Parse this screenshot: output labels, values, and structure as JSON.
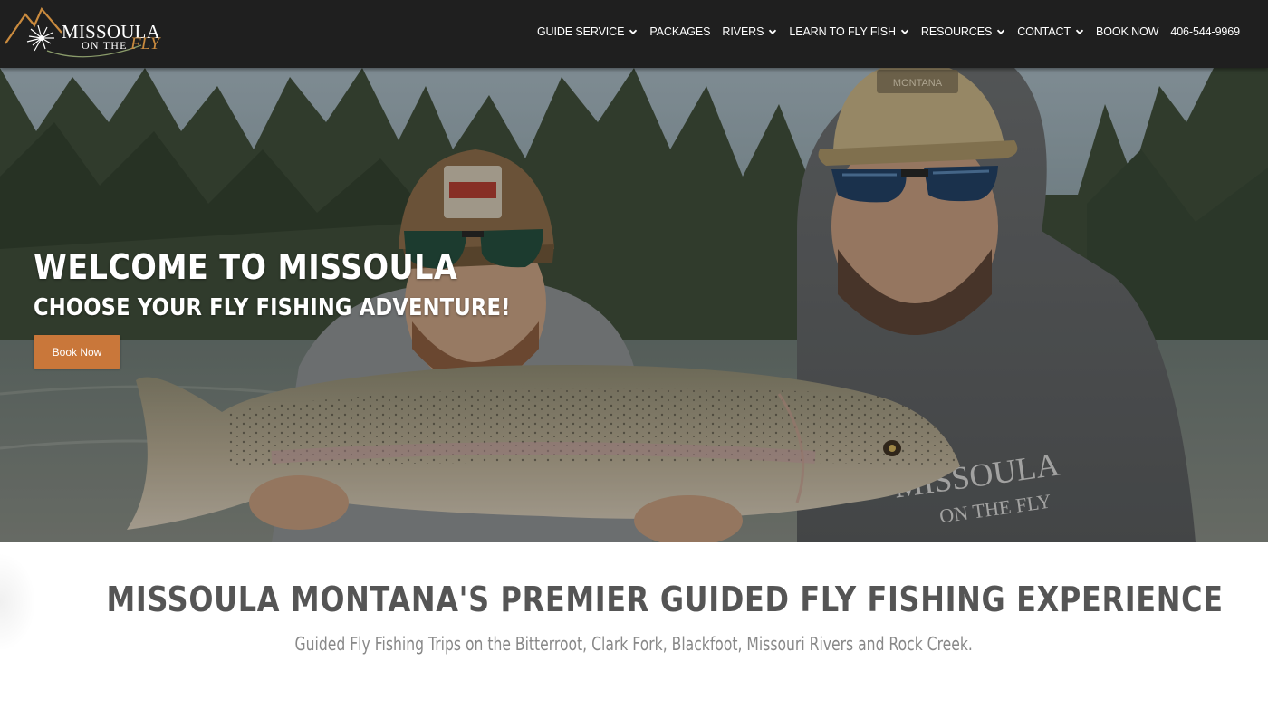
{
  "brand": {
    "logo_line1": "MISSOULA",
    "logo_line2": "ON THE",
    "logo_line3": "FLY"
  },
  "nav": {
    "items": [
      {
        "label": "GUIDE SERVICE",
        "has_dropdown": true
      },
      {
        "label": "PACKAGES",
        "has_dropdown": false
      },
      {
        "label": "RIVERS",
        "has_dropdown": true
      },
      {
        "label": "LEARN TO FLY FISH",
        "has_dropdown": true
      },
      {
        "label": "RESOURCES",
        "has_dropdown": true
      },
      {
        "label": "CONTACT",
        "has_dropdown": true
      },
      {
        "label": "BOOK NOW",
        "has_dropdown": false
      },
      {
        "label": "406-544-9969",
        "has_dropdown": false
      }
    ]
  },
  "hero": {
    "title": "WELCOME TO MISSOULA",
    "subtitle": "CHOOSE YOUR FLY FISHING ADVENTURE!",
    "button_label": "Book Now",
    "hat_text": "MONTANA",
    "hoodie_logo_line1": "MISSOULA",
    "hoodie_logo_line2": "ON THE FLY"
  },
  "intro": {
    "title": "MISSOULA MONTANA'S PREMIER GUIDED FLY FISHING EXPERIENCE",
    "subtitle": "Guided Fly Fishing Trips on the Bitterroot, Clark Fork, Blackfoot, Missouri Rivers and Rock Creek."
  },
  "colors": {
    "header_bg": "#1f1f1f",
    "accent": "#c9773a",
    "logo_fly": "#c98a3e",
    "intro_title": "#555555",
    "intro_sub": "#888888"
  },
  "icons": {
    "dropdown": "chevron-down-icon",
    "logo": "fly-fishing-logo-icon"
  }
}
